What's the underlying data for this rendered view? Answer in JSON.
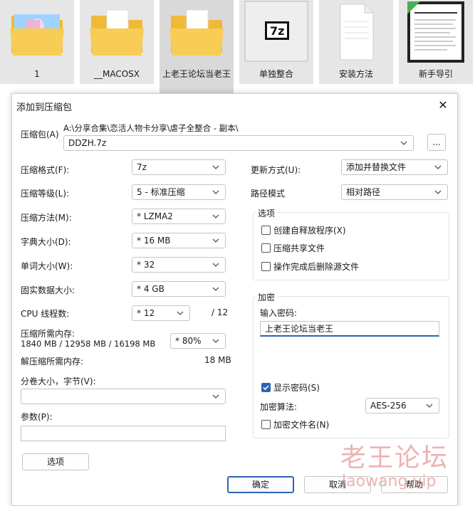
{
  "explorer": {
    "items": [
      {
        "label": "1",
        "type": "folder-image"
      },
      {
        "label": "__MACOSX",
        "type": "folder"
      },
      {
        "label": "上老王论坛当老王",
        "type": "folder"
      },
      {
        "label": "单独整合",
        "type": "7z-icon"
      },
      {
        "label": "安装方法",
        "type": "document"
      },
      {
        "label": "新手导引",
        "type": "image-doc"
      }
    ]
  },
  "dialog": {
    "title": "添加到压缩包",
    "close": "✕",
    "archive": {
      "label": "压缩包(A)",
      "path": "A:\\分享合集\\恋活人物卡分享\\虐子全整合 - 副本\\",
      "name": "DDZH.7z",
      "browse": "..."
    },
    "left": {
      "format": {
        "label": "压缩格式(F):",
        "value": "7z"
      },
      "level": {
        "label": "压缩等级(L):",
        "value": "5 - 标准压缩"
      },
      "method": {
        "label": "压缩方法(M):",
        "value": "* LZMA2"
      },
      "dict": {
        "label": "字典大小(D):",
        "value": "* 16 MB"
      },
      "word": {
        "label": "单词大小(W):",
        "value": "* 32"
      },
      "solid": {
        "label": "固实数据大小:",
        "value": "* 4 GB"
      },
      "threads": {
        "label": "CPU 线程数:",
        "value": "* 12",
        "max": "/ 12"
      },
      "mem": {
        "label": "压缩所需内存:",
        "values": "1840 MB / 12958 MB / 16198 MB",
        "percent": "* 80%"
      },
      "decomp": {
        "label": "解压缩所需内存:",
        "value": "18 MB"
      },
      "split": {
        "label": "分卷大小，字节(V):",
        "value": ""
      },
      "params": {
        "label": "参数(P):",
        "value": ""
      },
      "options_button": "选项"
    },
    "right": {
      "update": {
        "label": "更新方式(U):",
        "value": "添加并替换文件"
      },
      "pathmode": {
        "label": "路径模式",
        "value": "相对路径"
      },
      "options": {
        "title": "选项",
        "sfx": {
          "label": "创建自释放程序(X)",
          "checked": false
        },
        "shared": {
          "label": "压缩共享文件",
          "checked": false
        },
        "delete": {
          "label": "操作完成后删除源文件",
          "checked": false
        }
      },
      "encryption": {
        "title": "加密",
        "password_label": "输入密码:",
        "password": "上老王论坛当老王",
        "show": {
          "label": "显示密码(S)",
          "checked": true
        },
        "method_label": "加密算法:",
        "method": "AES-256",
        "encrypt_names": {
          "label": "加密文件名(N)",
          "checked": false
        }
      }
    },
    "buttons": {
      "ok": "确定",
      "cancel": "取消",
      "help": "帮助"
    }
  },
  "watermark": {
    "line1": "老王论坛",
    "line2": "laowang.vip"
  },
  "colors": {
    "accent": "#2b63b6",
    "folder": "#f5c84b",
    "watermark": "#e89a9a"
  }
}
